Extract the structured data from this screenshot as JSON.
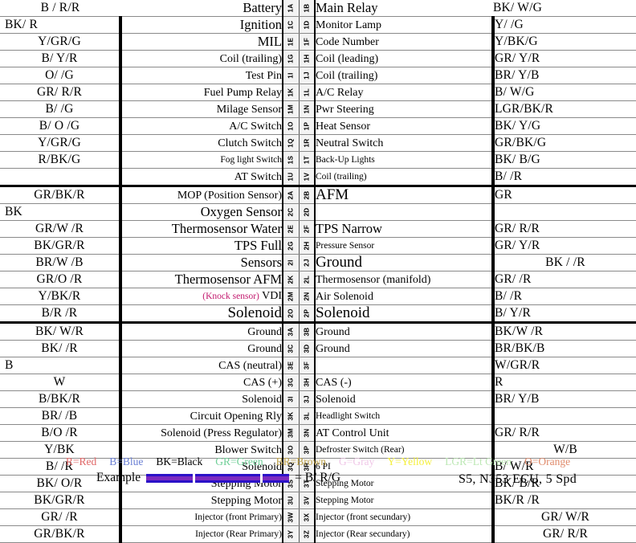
{
  "document": {
    "caption": "S5,  N353 ECU,  5 Spd"
  },
  "legend": {
    "entries": [
      {
        "text": "R=Red",
        "color": "#e06666"
      },
      {
        "text": "B=Blue",
        "color": "#6a7fd4"
      },
      {
        "text": "BK=Black",
        "color": "#000000"
      },
      {
        "text": "GR=Green",
        "color": "#6fcf97"
      },
      {
        "text": "BR=Brown",
        "color": "#bda14a"
      },
      {
        "text": "G=Gray",
        "color": "#f0c8e8"
      },
      {
        "text": "Y=Yellow",
        "color": "#f4ef3a"
      },
      {
        "text": "LGR=Lt Green",
        "color": "#bde8b5"
      },
      {
        "text": "O=Orange",
        "color": "#e08a6a"
      }
    ],
    "example_label": "Example",
    "example_equals": "= B/ R/G",
    "example_swatch": {
      "base": "#2b12c8",
      "stripe": "#7d2bbf",
      "tick": "#ffffff"
    }
  },
  "rows": [
    {
      "pinA": "1A",
      "pinB": "1B",
      "lwire": "B / R/R",
      "lfunc": "Battery",
      "lsize": "sz-lg",
      "rfunc": "Main Relay",
      "rsize": "sz-lg",
      "rwire": "BK/ W/G"
    },
    {
      "pinA": "1C",
      "pinB": "1D",
      "lwire": "BK/ R",
      "lfunc": "Ignition",
      "lsize": "sz-lg",
      "rfunc": "Monitor Lamp",
      "rsize": "sz-md",
      "rwire": "Y/   /G"
    },
    {
      "pinA": "1E",
      "pinB": "1F",
      "lwire": "Y/GR/G",
      "lfunc": "MIL",
      "lsize": "sz-lg",
      "rfunc": "Code Number",
      "rsize": "sz-md",
      "rwire": "Y/BK/G"
    },
    {
      "pinA": "1G",
      "pinB": "1H",
      "lwire": "B/ Y/R",
      "lfunc": "Coil (trailing)",
      "lsize": "sz-md",
      "rfunc": "Coil (leading)",
      "rsize": "sz-md",
      "rwire": "GR/ Y/R"
    },
    {
      "pinA": "1I",
      "pinB": "1J",
      "lwire": "O/    /G",
      "lfunc": "Test Pin",
      "lsize": "sz-md",
      "rfunc": "Coil (trailing)",
      "rsize": "sz-md",
      "rwire": "BR/ Y/B"
    },
    {
      "pinA": "1K",
      "pinB": "1L",
      "lwire": "GR/ R/R",
      "lfunc": "Fuel Pump Relay",
      "lsize": "sz-md",
      "rfunc": "A/C Relay",
      "rsize": "sz-md",
      "rwire": "B/ W/G"
    },
    {
      "pinA": "1M",
      "pinB": "1N",
      "lwire": "B/    /G",
      "lfunc": "Milage Sensor",
      "lsize": "sz-md",
      "rfunc": "Pwr Steering",
      "rsize": "sz-md",
      "rwire": "LGR/BK/R"
    },
    {
      "pinA": "1O",
      "pinB": "1P",
      "lwire": "B/ O /G",
      "lfunc": "A/C Switch",
      "lsize": "sz-md",
      "rfunc": "Heat Sensor",
      "rsize": "sz-md",
      "rwire": "BK/ Y/G"
    },
    {
      "pinA": "1Q",
      "pinB": "1R",
      "lwire": "Y/GR/G",
      "lfunc": "Clutch Switch",
      "lsize": "sz-md",
      "rfunc": "Neutral Switch",
      "rsize": "sz-md",
      "rwire": "GR/BK/G"
    },
    {
      "pinA": "1S",
      "pinB": "1T",
      "lwire": "R/BK/G",
      "lfunc": "Fog light Switch",
      "lsize": "sz-sm",
      "rfunc": "Back-Up Lights",
      "rsize": "sz-sm",
      "rwire": "BK/ B/G"
    },
    {
      "pinA": "1U",
      "pinB": "1V",
      "lwire": "",
      "lfunc": "AT Switch",
      "lsize": "sz-md",
      "rfunc": "Coil (trailing)",
      "rsize": "sz-sm",
      "rwire": "B/    /R",
      "grpend": true
    },
    {
      "pinA": "2A",
      "pinB": "2B",
      "lwire": "GR/BK/R",
      "lfunc": "MOP (Position Sensor)",
      "lsize": "sz-md",
      "rfunc": "AFM",
      "rsize": "sz-xl",
      "rwire": "GR"
    },
    {
      "pinA": "2C",
      "pinB": "2D",
      "lwire": "BK",
      "lfunc": "Oxygen Sensor",
      "lsize": "sz-lg",
      "rfunc": "",
      "rsize": "sz-md",
      "rwire": ""
    },
    {
      "pinA": "2E",
      "pinB": "2F",
      "lwire": "GR/W /R",
      "lfunc": "Thermosensor Water",
      "lsize": "sz-lg",
      "rfunc": "TPS Narrow",
      "rsize": "sz-lg",
      "rwire": "GR/ R/R"
    },
    {
      "pinA": "2G",
      "pinB": "2H",
      "lwire": "BK/GR/R",
      "lfunc": "TPS Full",
      "lsize": "sz-lg",
      "rfunc": "Pressure Sensor",
      "rsize": "sz-sm",
      "rwire": "GR/ Y/R"
    },
    {
      "pinA": "2I",
      "pinB": "2J",
      "lwire": "BR/W /B",
      "lfunc": "Sensors",
      "lsize": "sz-lg",
      "rfunc": "Ground",
      "rsize": "sz-xl",
      "rwire": "BK /   /R",
      "rctr": true
    },
    {
      "pinA": "2K",
      "pinB": "2L",
      "lwire": "GR/O /R",
      "lfunc": "Thermosensor AFM",
      "lsize": "sz-lg",
      "rfunc": "Thermosensor (manifold)",
      "rsize": "sz-md",
      "rwire": "GR/   /R"
    },
    {
      "pinA": "2M",
      "pinB": "2N",
      "lwire": "Y/BK/R",
      "lfunc": "(Knock sensor) VDI",
      "lsize": "sz-md",
      "rfunc": "Air Solenoid",
      "rsize": "sz-md",
      "rwire": "B/    /R",
      "knock": "(Knock sensor)",
      "lplain": "VDI"
    },
    {
      "pinA": "2O",
      "pinB": "2P",
      "lwire": "B/R /R",
      "lfunc": "Solenoid",
      "lsize": "sz-xl",
      "rfunc": "Solenoid",
      "rsize": "sz-xl",
      "rwire": "B/ Y/R",
      "grpend": true
    },
    {
      "pinA": "3A",
      "pinB": "3B",
      "lwire": "BK/ W/R",
      "lfunc": "Ground",
      "lsize": "sz-md",
      "rfunc": "Ground",
      "rsize": "sz-md",
      "rwire": "BK/W /R"
    },
    {
      "pinA": "3C",
      "pinB": "3D",
      "lwire": "BK/   /R",
      "lfunc": "Ground",
      "lsize": "sz-md",
      "rfunc": "Ground",
      "rsize": "sz-md",
      "rwire": "BR/BK/B"
    },
    {
      "pinA": "3E",
      "pinB": "3F",
      "lwire": "B",
      "lfunc": "CAS (neutral)",
      "lsize": "sz-md",
      "rfunc": "",
      "rsize": "sz-md",
      "rwire": "W/GR/R"
    },
    {
      "pinA": "3G",
      "pinB": "3H",
      "lwire": "W",
      "lfunc": "CAS (+)",
      "lsize": "sz-md",
      "rfunc": "CAS (-)",
      "rsize": "sz-md",
      "rwire": "R"
    },
    {
      "pinA": "3I",
      "pinB": "3J",
      "lwire": "B/BK/R",
      "lfunc": "Solenoid",
      "lsize": "sz-md",
      "rfunc": "Solenoid",
      "rsize": "sz-md",
      "rwire": "BR/ Y/B"
    },
    {
      "pinA": "3K",
      "pinB": "3L",
      "lwire": "BR/   /B",
      "lfunc": "Circuit Opening Rly",
      "lsize": "sz-md",
      "rfunc": "Headlight Switch",
      "rsize": "sz-sm",
      "rwire": ""
    },
    {
      "pinA": "3M",
      "pinB": "3N",
      "lwire": "B/O /R",
      "lfunc": "Solenoid (Press Regulator)",
      "lsize": "sz-md",
      "rfunc": "AT Control Unit",
      "rsize": "sz-md",
      "rwire": "GR/ R/R"
    },
    {
      "pinA": "3O",
      "pinB": "3P",
      "lwire": "Y/BK",
      "lfunc": "Blower Switch",
      "lsize": "sz-md",
      "rfunc": "Defroster Switch (Rear)",
      "rsize": "sz-sm",
      "rwire": "W/B",
      "rctr": true
    },
    {
      "pinA": "3Q",
      "pinB": "3R",
      "lwire": "B/   /R",
      "lfunc": "Solenoid",
      "lsize": "sz-md",
      "rfunc": "6 PI",
      "rsize": "sz-sm",
      "rwire": "B/ W/R"
    },
    {
      "pinA": "3S",
      "pinB": "3T",
      "lwire": "BK/ O/R",
      "lfunc": "Stepping Motor",
      "lsize": "sz-md",
      "rfunc": "Stepping Motor",
      "rsize": "sz-sm",
      "rwire": "BK/ B/R"
    },
    {
      "pinA": "3U",
      "pinB": "3V",
      "lwire": "BK/GR/R",
      "lfunc": "Stepping Motor",
      "lsize": "sz-md",
      "rfunc": "Stepping Motor",
      "rsize": "sz-sm",
      "rwire": "BK/R /R"
    },
    {
      "pinA": "3W",
      "pinB": "3X",
      "lwire": "GR/   /R",
      "lfunc": "Injector (front Primary)",
      "lsize": "sz-sm",
      "rfunc": "Injector (front secundary)",
      "rsize": "sz-sm",
      "rwire": "GR/ W/R",
      "rctr": true
    },
    {
      "pinA": "3Y",
      "pinB": "3Z",
      "lwire": "GR/BK/R",
      "lfunc": "Injector (Rear Primary)",
      "lsize": "sz-sm",
      "rfunc": "Injector (Rear secundary)",
      "rsize": "sz-sm",
      "rwire": "GR/ R/R",
      "rctr": true
    }
  ]
}
